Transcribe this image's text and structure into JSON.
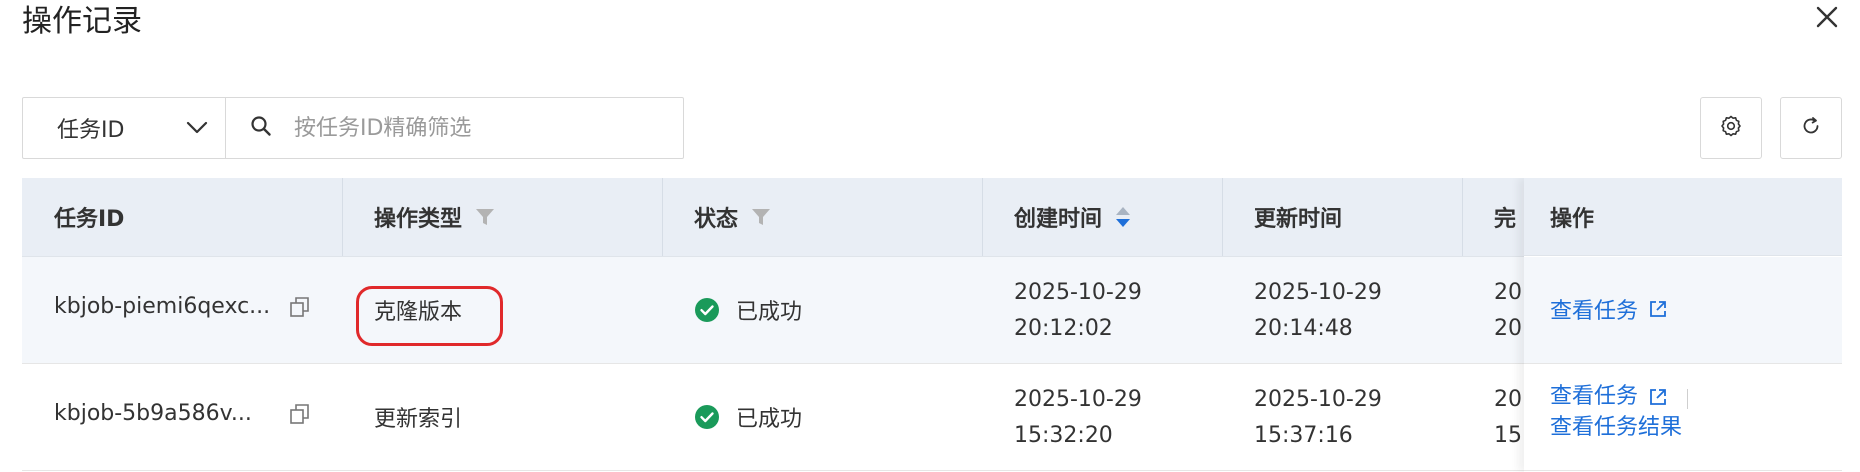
{
  "dialog": {
    "title": "操作记录"
  },
  "filter": {
    "field_selected": "任务ID",
    "search_placeholder": "按任务ID精确筛选",
    "search_value": ""
  },
  "table": {
    "headers": {
      "task_id": "任务ID",
      "op_type": "操作类型",
      "status": "状态",
      "created": "创建时间",
      "updated": "更新时间",
      "completed_partial": "完",
      "actions": "操作"
    },
    "rows": [
      {
        "task_id": "kbjob-piemi6qexc...",
        "op_type": "克隆版本",
        "status": "已成功",
        "created_date": "2025-10-29",
        "created_time": "20:12:02",
        "updated_date": "2025-10-29",
        "updated_time": "20:14:48",
        "completed_a": "20",
        "completed_b": "20",
        "actions": [
          "查看任务"
        ]
      },
      {
        "task_id": "kbjob-5b9a586v...",
        "op_type": "更新索引",
        "status": "已成功",
        "created_date": "2025-10-29",
        "created_time": "15:32:20",
        "updated_date": "2025-10-29",
        "updated_time": "15:37:16",
        "completed_a": "20",
        "completed_b": "15",
        "actions": [
          "查看任务",
          "查看任务结果"
        ]
      }
    ]
  },
  "colors": {
    "link": "#1e6fd9",
    "success": "#1a9a5a",
    "highlight_border": "#e0292b",
    "sort_active": "#1e6fd9"
  }
}
